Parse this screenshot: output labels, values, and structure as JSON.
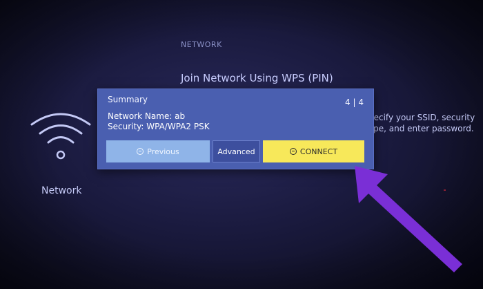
{
  "header": {
    "section": "NETWORK",
    "title": "Join Network Using WPS (PIN)"
  },
  "help": {
    "line1": "pecify your SSID, security",
    "line2": "ype, and enter password."
  },
  "sidebar": {
    "network_label": "Network",
    "icon": "wifi-icon"
  },
  "dialog": {
    "title": "Summary",
    "counter": "4 | 4",
    "network_name": "Network Name: ab",
    "security": "Security: WPA/WPA2 PSK",
    "buttons": {
      "previous": "Previous",
      "advanced": "Advanced",
      "connect": "CONNECT"
    }
  },
  "colors": {
    "dialog_bg": "#4a5fb0",
    "connect_bg": "#f7e85a",
    "previous_bg": "#8fb4e8",
    "arrow": "#7a2fd6"
  }
}
